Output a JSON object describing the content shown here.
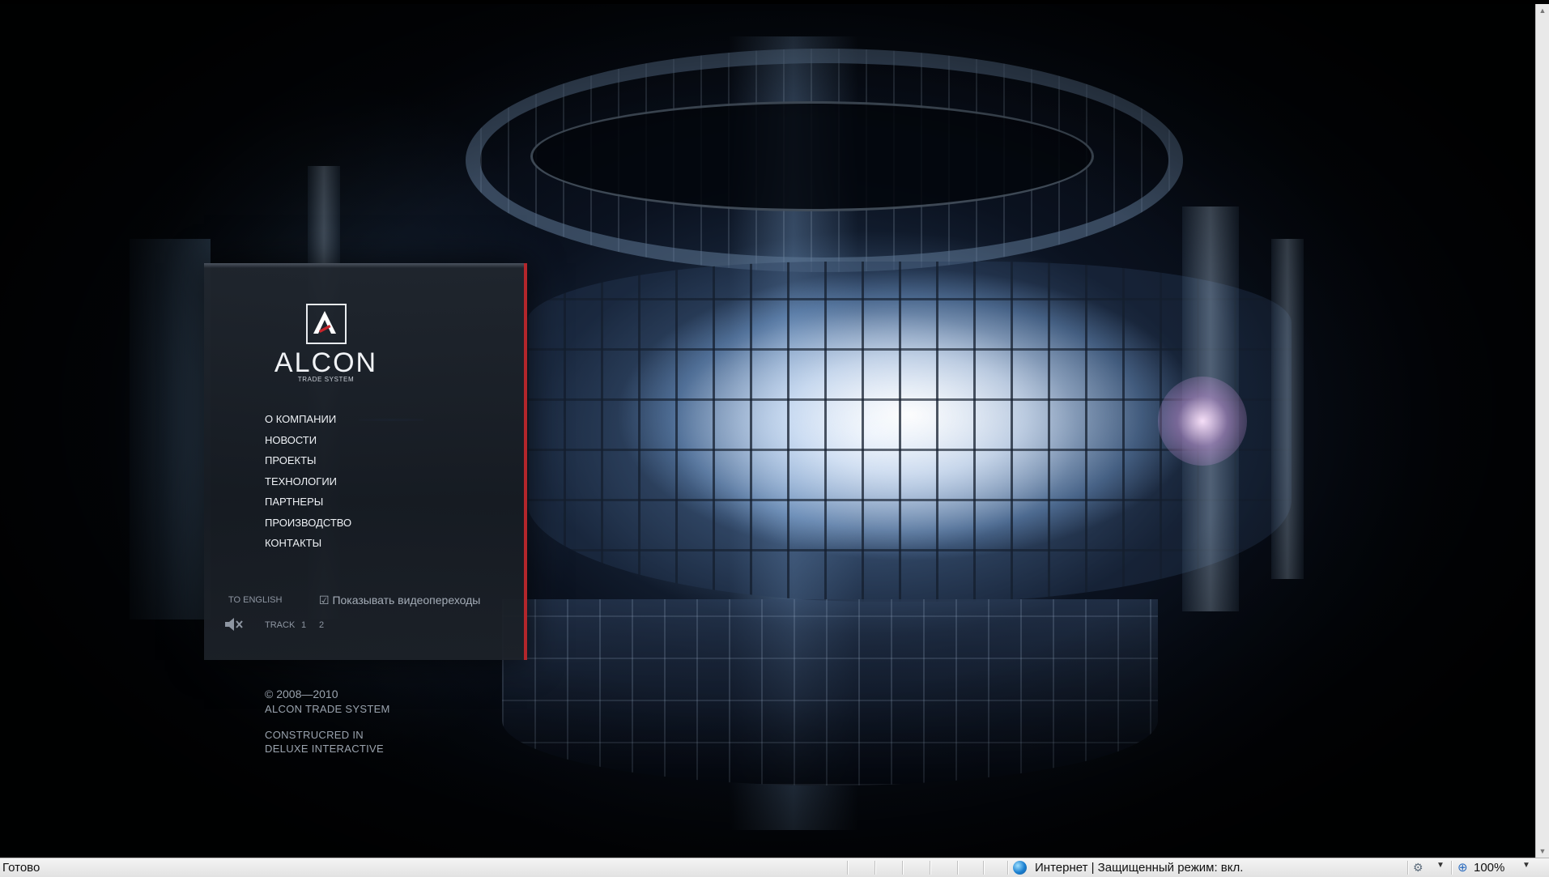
{
  "brand": {
    "name": "ALCON",
    "tagline": "TRADE SYSTEM"
  },
  "nav": {
    "items": [
      {
        "label": "О КОМПАНИИ",
        "active": true
      },
      {
        "label": "НОВОСТИ"
      },
      {
        "label": "ПРОЕКТЫ"
      },
      {
        "label": "ТЕХНОЛОГИИ"
      },
      {
        "label": "ПАРТНЕРЫ"
      },
      {
        "label": "ПРОИЗВОДСТВО"
      },
      {
        "label": "КОНТАКТЫ"
      }
    ]
  },
  "controls": {
    "language_link": "TO ENGLISH",
    "video_toggle": "☑ Показывать видеопереходы",
    "track_label": "TRACK",
    "track_1": "1",
    "track_2": "2"
  },
  "footer": {
    "copyright": "© 2008—2010",
    "company": "ALCON  TRADE SYSTEM",
    "credit_line1": "CONSTRUCRED IN",
    "credit_line2": "DELUXE INTERACTIVE"
  },
  "statusbar": {
    "status": "Готово",
    "zone": "Интернет | Защищенный режим: вкл.",
    "zoom": "100%"
  },
  "colors": {
    "accent_red": "#b3262b",
    "active_indicator_blue": "#2f6ff0",
    "panel_bg": "#1e242c"
  },
  "icons": {
    "logo": "alcon-logo-icon",
    "speaker": "speaker-muted-icon",
    "zone": "internet-globe-icon",
    "zoom": "magnifier-icon"
  }
}
